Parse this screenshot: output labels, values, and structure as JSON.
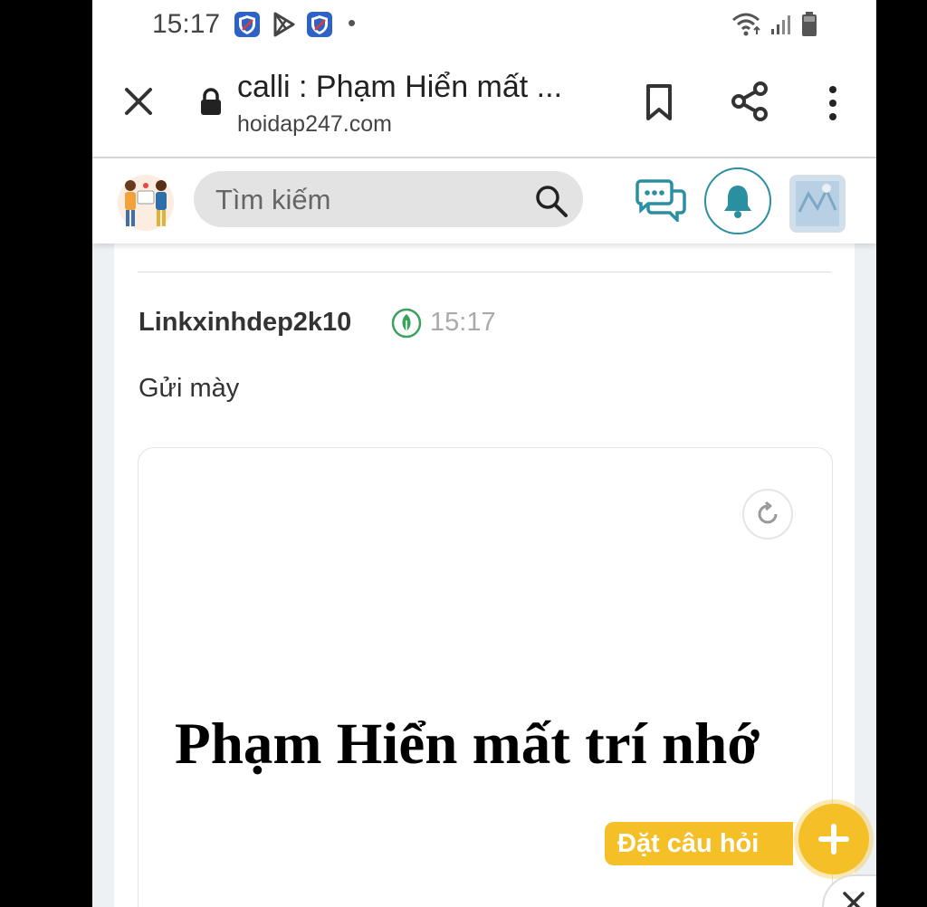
{
  "status_bar": {
    "time": "15:17",
    "dot": "•"
  },
  "browser": {
    "page_title": "calli : Phạm Hiển mất ...",
    "host": "hoidap247.com"
  },
  "site": {
    "search": {
      "placeholder": "Tìm kiếm"
    }
  },
  "comment": {
    "author": "Linkxinhdep2k10",
    "time": "15:17",
    "text": "Gửi mày",
    "image_text": "Phạm Hiển mất trí nhớ"
  },
  "fab": {
    "label": "Đặt câu hỏi"
  },
  "colors": {
    "accent_yellow": "#f4bf27",
    "teal": "#2a8fa0",
    "leaf_green": "#3aa35a"
  }
}
